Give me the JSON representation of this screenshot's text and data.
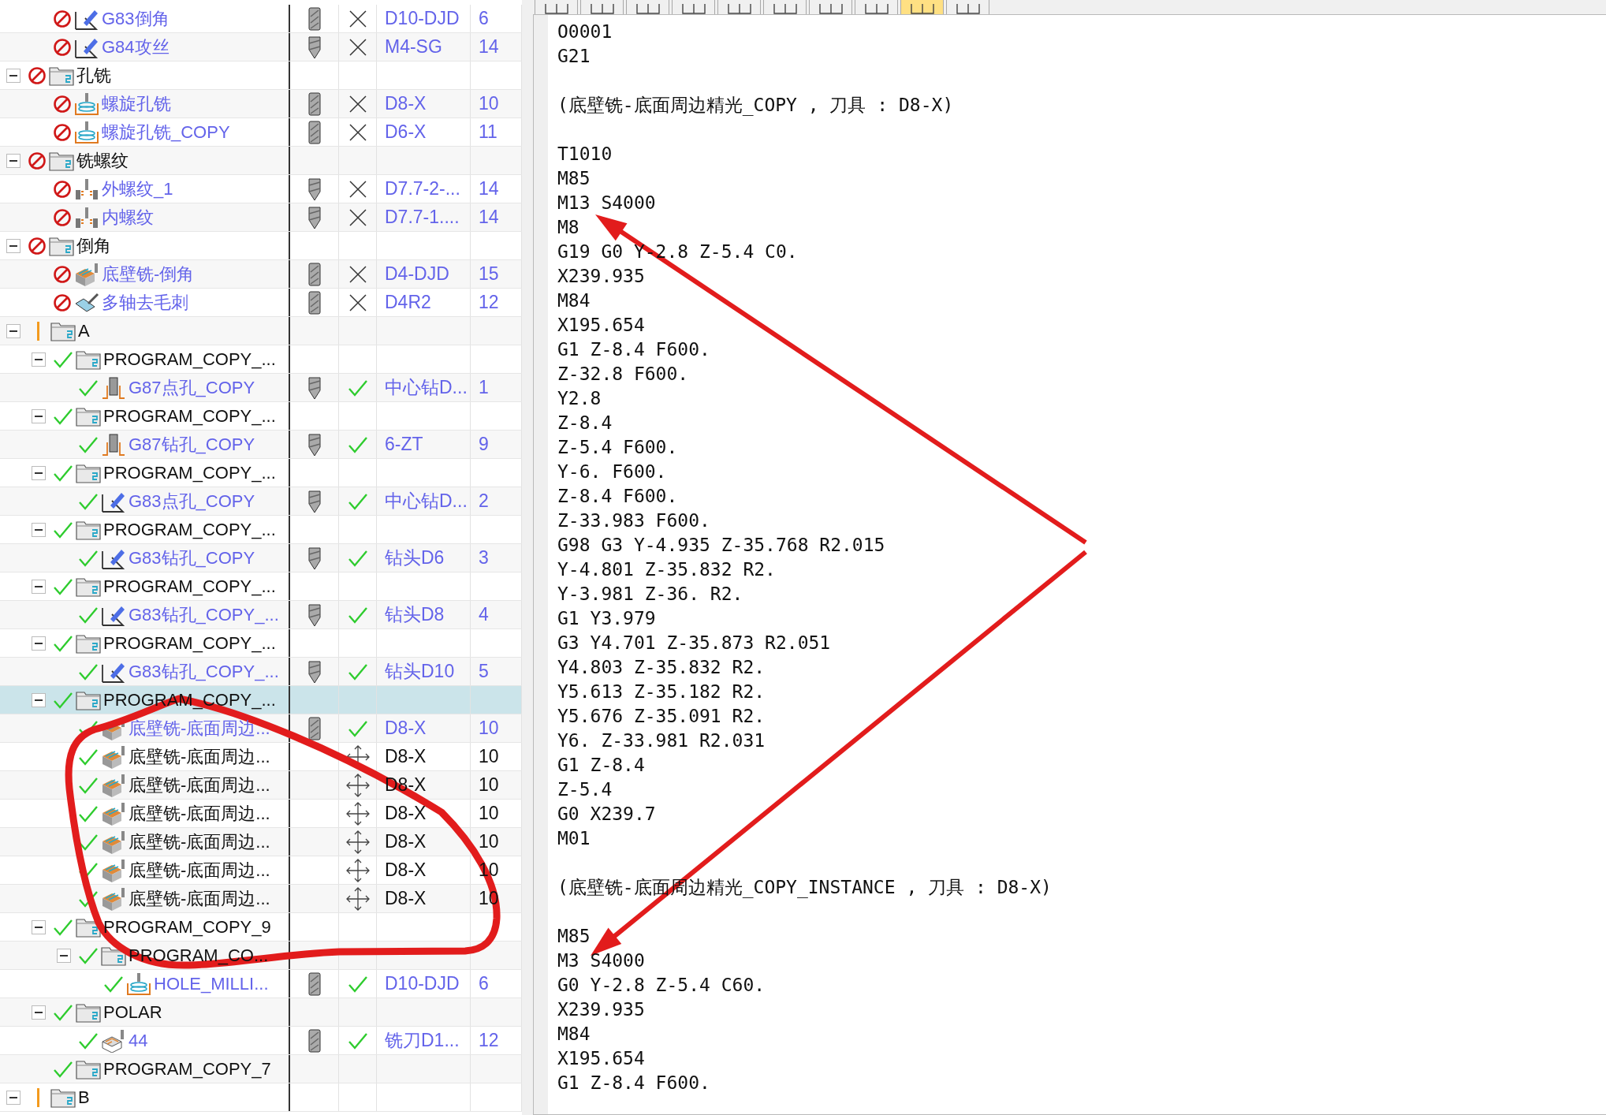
{
  "tree": [
    {
      "children": [
        {
          "kind": "operation",
          "name": "G83倒角",
          "selected": false,
          "status": {
            "kind": "disabled"
          },
          "icon": {
            "kind": "drill_cycle"
          },
          "tool_icon": {
            "kind": "endmill"
          },
          "generated": false,
          "tool": "D10-DJD",
          "number": "6"
        },
        {
          "kind": "operation",
          "name": "G84攻丝",
          "selected": false,
          "status": {
            "kind": "disabled"
          },
          "icon": {
            "kind": "drill_cycle"
          },
          "tool_icon": {
            "kind": "drill"
          },
          "generated": false,
          "tool": "M4-SG",
          "number": "14"
        }
      ]
    },
    {
      "kind": "group",
      "name": "孔铣",
      "selected": false,
      "status": {
        "kind": "disabled"
      },
      "expanded": true,
      "children": [
        {
          "kind": "operation",
          "name": "螺旋孔铣",
          "selected": false,
          "status": {
            "kind": "disabled"
          },
          "icon": {
            "kind": "hole_milling"
          },
          "tool_icon": {
            "kind": "endmill"
          },
          "generated": false,
          "tool": "D8-X",
          "number": "10"
        },
        {
          "kind": "operation",
          "name": "螺旋孔铣_COPY",
          "selected": false,
          "status": {
            "kind": "disabled"
          },
          "icon": {
            "kind": "hole_milling"
          },
          "tool_icon": {
            "kind": "endmill"
          },
          "generated": false,
          "tool": "D6-X",
          "number": "11"
        }
      ]
    },
    {
      "kind": "group",
      "name": "铣螺纹",
      "selected": false,
      "status": {
        "kind": "disabled"
      },
      "expanded": true,
      "children": [
        {
          "kind": "operation",
          "name": "外螺纹_1",
          "selected": false,
          "status": {
            "kind": "disabled"
          },
          "icon": {
            "kind": "thread_milling"
          },
          "tool_icon": {
            "kind": "drill"
          },
          "generated": false,
          "tool": "D7.7-2-...",
          "number": "14"
        },
        {
          "kind": "operation",
          "name": "内螺纹",
          "selected": false,
          "status": {
            "kind": "disabled"
          },
          "icon": {
            "kind": "thread_milling"
          },
          "tool_icon": {
            "kind": "drill"
          },
          "generated": false,
          "tool": "D7.7-1....",
          "number": "14"
        }
      ]
    },
    {
      "kind": "group",
      "name": "倒角",
      "selected": false,
      "status": {
        "kind": "disabled"
      },
      "expanded": true,
      "children": [
        {
          "kind": "operation",
          "name": "底壁铣-倒角",
          "selected": false,
          "status": {
            "kind": "disabled"
          },
          "icon": {
            "kind": "floor_wall"
          },
          "tool_icon": {
            "kind": "endmill"
          },
          "generated": false,
          "tool": "D4-DJD",
          "number": "15"
        },
        {
          "kind": "operation",
          "name": "多轴去毛刺",
          "selected": false,
          "status": {
            "kind": "disabled"
          },
          "icon": {
            "kind": "deburr"
          },
          "tool_icon": {
            "kind": "endmill"
          },
          "generated": false,
          "tool": "D4R2",
          "number": "12"
        }
      ]
    },
    {
      "kind": "group",
      "name": "A",
      "selected": false,
      "status": {
        "kind": "warning"
      },
      "expanded": true,
      "children": [
        {
          "kind": "group",
          "name": "PROGRAM_COPY_...",
          "selected": false,
          "status": {
            "kind": "ok"
          },
          "expanded": true,
          "children": [
            {
              "kind": "operation",
              "name": "G87点孔_COPY",
              "selected": false,
              "status": {
                "kind": "ok"
              },
              "icon": {
                "kind": "spot_drill"
              },
              "tool_icon": {
                "kind": "drill"
              },
              "generated": true,
              "tool": "中心钻D...",
              "number": "1"
            }
          ]
        },
        {
          "kind": "group",
          "name": "PROGRAM_COPY_...",
          "selected": false,
          "status": {
            "kind": "ok"
          },
          "expanded": true,
          "children": [
            {
              "kind": "operation",
              "name": "G87钻孔_COPY",
              "selected": false,
              "status": {
                "kind": "ok"
              },
              "icon": {
                "kind": "spot_drill"
              },
              "tool_icon": {
                "kind": "drill"
              },
              "generated": true,
              "tool": "6-ZT",
              "number": "9"
            }
          ]
        },
        {
          "kind": "group",
          "name": "PROGRAM_COPY_...",
          "selected": false,
          "status": {
            "kind": "ok"
          },
          "expanded": true,
          "children": [
            {
              "kind": "operation",
              "name": "G83点孔_COPY",
              "selected": false,
              "status": {
                "kind": "ok"
              },
              "icon": {
                "kind": "drill_cycle"
              },
              "tool_icon": {
                "kind": "drill"
              },
              "generated": true,
              "tool": "中心钻D...",
              "number": "2"
            }
          ]
        },
        {
          "kind": "group",
          "name": "PROGRAM_COPY_...",
          "selected": false,
          "status": {
            "kind": "ok"
          },
          "expanded": true,
          "children": [
            {
              "kind": "operation",
              "name": "G83钻孔_COPY",
              "selected": false,
              "status": {
                "kind": "ok"
              },
              "icon": {
                "kind": "drill_cycle"
              },
              "tool_icon": {
                "kind": "drill"
              },
              "generated": true,
              "tool": "钻头D6",
              "number": "3"
            }
          ]
        },
        {
          "kind": "group",
          "name": "PROGRAM_COPY_...",
          "selected": false,
          "status": {
            "kind": "ok"
          },
          "expanded": true,
          "children": [
            {
              "kind": "operation",
              "name": "G83钻孔_COPY_...",
              "selected": false,
              "status": {
                "kind": "ok"
              },
              "icon": {
                "kind": "drill_cycle"
              },
              "tool_icon": {
                "kind": "drill"
              },
              "generated": true,
              "tool": "钻头D8",
              "number": "4"
            }
          ]
        },
        {
          "kind": "group",
          "name": "PROGRAM_COPY_...",
          "selected": false,
          "status": {
            "kind": "ok"
          },
          "expanded": true,
          "children": [
            {
              "kind": "operation",
              "name": "G83钻孔_COPY_...",
              "selected": false,
              "status": {
                "kind": "ok"
              },
              "icon": {
                "kind": "drill_cycle"
              },
              "tool_icon": {
                "kind": "drill"
              },
              "generated": true,
              "tool": "钻头D10",
              "number": "5"
            }
          ]
        },
        {
          "kind": "group",
          "name": "PROGRAM_COPY_...",
          "selected": true,
          "status": {
            "kind": "ok"
          },
          "expanded": true,
          "children": [
            {
              "kind": "operation",
              "name": "底壁铣-底面周边...",
              "selected": false,
              "status": {
                "kind": "ok"
              },
              "icon": {
                "kind": "floor_wall"
              },
              "tool_icon": {
                "kind": "endmill"
              },
              "generated": true,
              "tool": "D8-X",
              "number": "10"
            },
            {
              "kind": "instance",
              "name": "底壁铣-底面周边...",
              "selected": false,
              "status": {
                "kind": "ok"
              },
              "icon": {
                "kind": "floor_wall"
              },
              "tool": "D8-X",
              "number": "10"
            },
            {
              "kind": "instance",
              "name": "底壁铣-底面周边...",
              "selected": false,
              "status": {
                "kind": "ok"
              },
              "icon": {
                "kind": "floor_wall"
              },
              "tool": "D8-X",
              "number": "10"
            },
            {
              "kind": "instance",
              "name": "底壁铣-底面周边...",
              "selected": false,
              "status": {
                "kind": "ok"
              },
              "icon": {
                "kind": "floor_wall"
              },
              "tool": "D8-X",
              "number": "10"
            },
            {
              "kind": "instance",
              "name": "底壁铣-底面周边...",
              "selected": false,
              "status": {
                "kind": "ok"
              },
              "icon": {
                "kind": "floor_wall"
              },
              "tool": "D8-X",
              "number": "10"
            },
            {
              "kind": "instance",
              "name": "底壁铣-底面周边...",
              "selected": false,
              "status": {
                "kind": "ok"
              },
              "icon": {
                "kind": "floor_wall"
              },
              "tool": "D8-X",
              "number": "10"
            },
            {
              "kind": "instance",
              "name": "底壁铣-底面周边...",
              "selected": false,
              "status": {
                "kind": "ok"
              },
              "icon": {
                "kind": "floor_wall"
              },
              "tool": "D8-X",
              "number": "10"
            }
          ]
        },
        {
          "kind": "group",
          "name": "PROGRAM_COPY_9",
          "selected": false,
          "status": {
            "kind": "ok"
          },
          "expanded": true,
          "children": [
            {
              "kind": "group",
              "name": "PROGRAM_CO...",
              "selected": false,
              "status": {
                "kind": "ok"
              },
              "expanded": true,
              "children": [
                {
                  "kind": "operation",
                  "name": "HOLE_MILLI...",
                  "selected": false,
                  "status": {
                    "kind": "ok"
                  },
                  "icon": {
                    "kind": "hole_milling"
                  },
                  "tool_icon": {
                    "kind": "endmill"
                  },
                  "generated": true,
                  "tool": "D10-DJD",
                  "number": "6"
                }
              ]
            }
          ]
        },
        {
          "kind": "group",
          "name": "POLAR",
          "selected": false,
          "status": {
            "kind": "ok"
          },
          "expanded": true,
          "children": [
            {
              "kind": "operation",
              "name": "44",
              "selected": false,
              "status": {
                "kind": "ok"
              },
              "icon": {
                "kind": "contour"
              },
              "tool_icon": {
                "kind": "endmill"
              },
              "generated": true,
              "tool": "铣刀D1...",
              "number": "12"
            }
          ]
        },
        {
          "kind": "group",
          "name": "PROGRAM_COPY_7",
          "selected": false,
          "status": {
            "kind": "ok"
          }
        }
      ]
    },
    {
      "kind": "group",
      "name": "B",
      "selected": false,
      "status": {
        "kind": "warning"
      },
      "expanded": true
    }
  ],
  "toolbar": [
    {
      "selected": false
    },
    {
      "selected": false
    },
    {
      "selected": false
    },
    {
      "selected": false
    },
    {
      "selected": false
    },
    {
      "selected": false
    },
    {
      "selected": false
    },
    {
      "selected": false
    },
    {
      "selected": true
    },
    {
      "selected": false
    }
  ],
  "code": [
    [
      "O0001",
      "G21"
    ],
    [
      "(底壁铣-底面周边精光_COPY , 刀具 : D8-X)"
    ],
    [
      "T1010",
      "M85",
      "M13 S4000",
      "M8",
      "G19 G0 Y-2.8 Z-5.4 C0.",
      "X239.935",
      "M84",
      "X195.654",
      "G1 Z-8.4 F600.",
      "Z-32.8 F600.",
      "Y2.8",
      "Z-8.4",
      "Z-5.4 F600.",
      "Y-6. F600.",
      "Z-8.4 F600.",
      "Z-33.983 F600.",
      "G98 G3 Y-4.935 Z-35.768 R2.015",
      "Y-4.801 Z-35.832 R2.",
      "Y-3.981 Z-36. R2.",
      "G1 Y3.979",
      "G3 Y4.701 Z-35.873 R2.051",
      "Y4.803 Z-35.832 R2.",
      "Y5.613 Z-35.182 R2.",
      "Y5.676 Z-35.091 R2.",
      "Y6. Z-33.981 R2.031",
      "G1 Z-8.4",
      "Z-5.4",
      "G0 X239.7",
      "M01"
    ],
    [
      "(底壁铣-底面周边精光_COPY_INSTANCE , 刀具 : D8-X)"
    ],
    [
      "M85",
      "M3 S4000",
      "G0 Y-2.8 Z-5.4 C60.",
      "X239.935",
      "M84",
      "X195.654",
      "G1 Z-8.4 F600."
    ]
  ],
  "annotations": [
    {
      "kind": "freehand_circle"
    },
    {
      "kind": "arrow"
    },
    {
      "kind": "arrow"
    }
  ]
}
